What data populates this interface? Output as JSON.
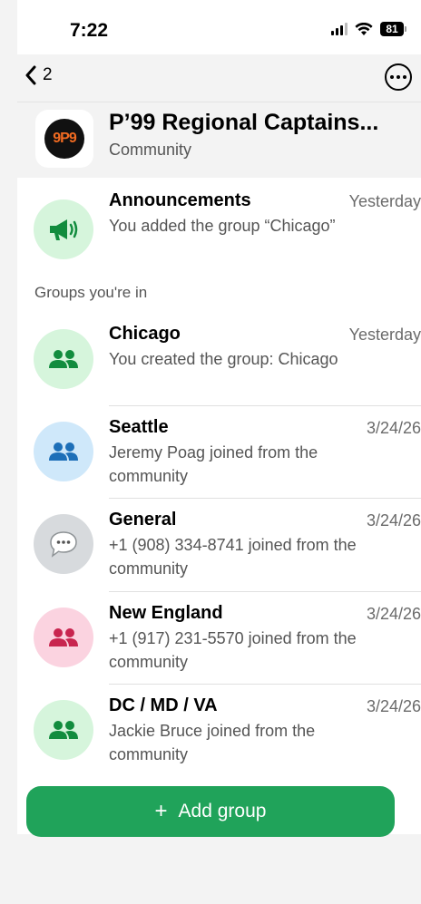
{
  "status_bar": {
    "time": "7:22",
    "battery": "81"
  },
  "nav": {
    "back_count": "2"
  },
  "community": {
    "name": "P’99 Regional Captains...",
    "subtitle": "Community",
    "logo_text": "9P9"
  },
  "announcements": {
    "title": "Announcements",
    "date": "Yesterday",
    "preview": "You added the group “Chicago”"
  },
  "section_label": "Groups you're in",
  "groups": [
    {
      "title": "Chicago",
      "date": "Yesterday",
      "preview": "You created the group: Chicago"
    },
    {
      "title": "Seattle",
      "date": "3/24/26",
      "preview": "Jeremy Poag joined from the community"
    },
    {
      "title": "General",
      "date": "3/24/26",
      "preview": "+1 (908) 334-8741 joined from the community"
    },
    {
      "title": "New England",
      "date": "3/24/26",
      "preview": "+1 (917) 231-5570 joined from the community"
    },
    {
      "title": "DC / MD / VA",
      "date": "3/24/26",
      "preview": "Jackie Bruce joined from the community"
    }
  ],
  "add_group": {
    "label": "Add group"
  },
  "colors": {
    "accent": "#20a35a",
    "green_avatar": "#d6f5dc",
    "blue_avatar": "#cfe8fa",
    "gray_avatar": "#d7dadd",
    "pink_avatar": "#fbd3e0"
  }
}
